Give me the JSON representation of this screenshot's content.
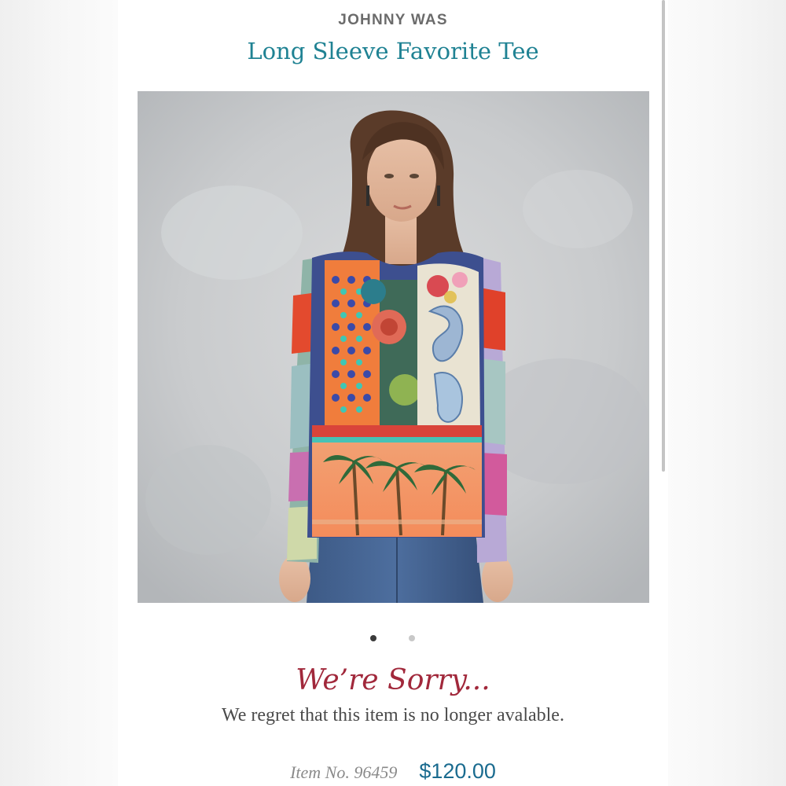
{
  "product": {
    "brand": "JOHNNY WAS",
    "title": "Long Sleeve Favorite Tee",
    "image_icon": "product-photo-model-printed-tee"
  },
  "gallery": {
    "total_images": 2,
    "active_index": 0
  },
  "notice": {
    "heading": "We’re Sorry...",
    "message": "We regret that this item is no longer avalable."
  },
  "details": {
    "item_number": "Item No. 96459",
    "price": "$120.00"
  },
  "colors": {
    "brand_text": "#6b6b6b",
    "title_teal": "#1f8293",
    "sorry_red": "#a1283b",
    "price_blue": "#1a6b8f"
  }
}
